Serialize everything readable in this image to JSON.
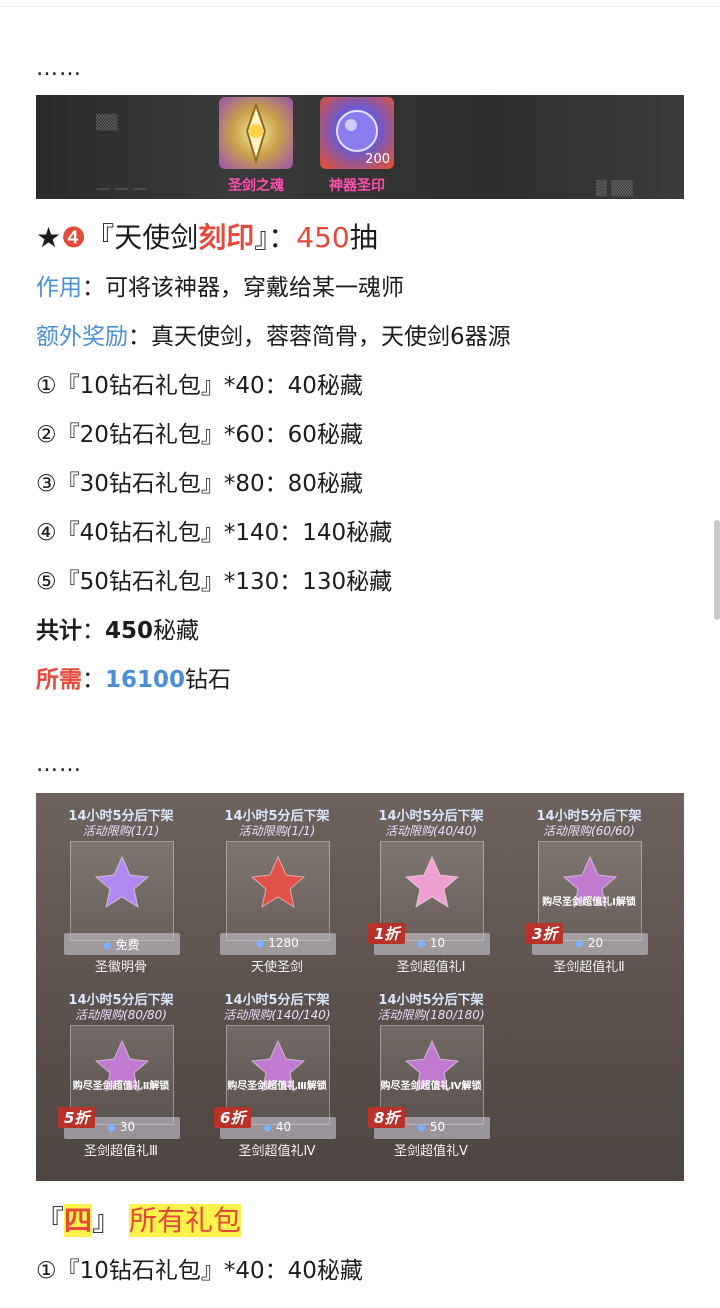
{
  "ellipsis_1": "……",
  "strip": {
    "icons": [
      {
        "label": "圣剑之魂",
        "color": "#c9a24a",
        "icon": "holy-sword-soul-icon"
      },
      {
        "label": "神器圣印",
        "color": "#d8523f",
        "icon": "artifact-seal-icon",
        "count": "200"
      }
    ]
  },
  "section4": {
    "star": "★",
    "num": "❹",
    "title_pre": "『天使剑",
    "title_bold": "刻印",
    "title_post": "』：",
    "draws": "450",
    "draws_unit": "抽",
    "effect_label": "作用",
    "effect_text": "：可将该神器，穿戴给某一魂师",
    "bonus_label": "额外奖励",
    "bonus_text": "：真天使剑，蓉蓉简骨，天使剑6器源",
    "items": [
      "①『10钻石礼包』*40：40秘藏",
      "②『20钻石礼包』*60：60秘藏",
      "③『30钻石礼包』*80：80秘藏",
      "④『40钻石礼包』*140：140秘藏",
      "⑤『50钻石礼包』*130：130秘藏"
    ],
    "total_label": "共计",
    "total_sep": "：",
    "total_value": "450",
    "total_unit": "秘藏",
    "need_label": "所需",
    "need_sep": "：",
    "need_value": "16100",
    "need_unit": "钻石"
  },
  "ellipsis_2": "……",
  "shop": {
    "boxes": [
      {
        "timer": "14小时5分后下架",
        "limit": "活动限购(1/1)",
        "price": "免费",
        "name": "圣徽明骨",
        "discount": "",
        "unlock": "",
        "gem": "#b08af0"
      },
      {
        "timer": "14小时5分后下架",
        "limit": "活动限购(1/1)",
        "price": "1280",
        "name": "天使圣剑",
        "discount": "",
        "unlock": "",
        "gem": "#e0514a"
      },
      {
        "timer": "14小时5分后下架",
        "limit": "活动限购(40/40)",
        "price": "10",
        "name": "圣剑超值礼Ⅰ",
        "discount": "1折",
        "unlock": "",
        "gem": "#f0a0d0"
      },
      {
        "timer": "14小时5分后下架",
        "limit": "活动限购(60/60)",
        "price": "20",
        "name": "圣剑超值礼Ⅱ",
        "discount": "3折",
        "unlock": "购尽圣剑超值礼Ⅰ解锁",
        "gem": "#c07ad0"
      },
      {
        "timer": "14小时5分后下架",
        "limit": "活动限购(80/80)",
        "price": "30",
        "name": "圣剑超值礼Ⅲ",
        "discount": "5折",
        "unlock": "购尽圣剑超值礼Ⅱ解锁",
        "gem": "#c07ad0"
      },
      {
        "timer": "14小时5分后下架",
        "limit": "活动限购(140/140)",
        "price": "40",
        "name": "圣剑超值礼Ⅳ",
        "discount": "6折",
        "unlock": "购尽圣剑超值礼Ⅲ解锁",
        "gem": "#c07ad0"
      },
      {
        "timer": "14小时5分后下架",
        "limit": "活动限购(180/180)",
        "price": "50",
        "name": "圣剑超值礼Ⅴ",
        "discount": "8折",
        "unlock": "购尽圣剑超值礼Ⅳ解锁",
        "gem": "#c07ad0"
      }
    ]
  },
  "section5": {
    "bracket_open": "『",
    "num": "四",
    "bracket_close": "』",
    "title": "所有礼包",
    "first_item": "①『10钻石礼包』*40：40秘藏"
  }
}
